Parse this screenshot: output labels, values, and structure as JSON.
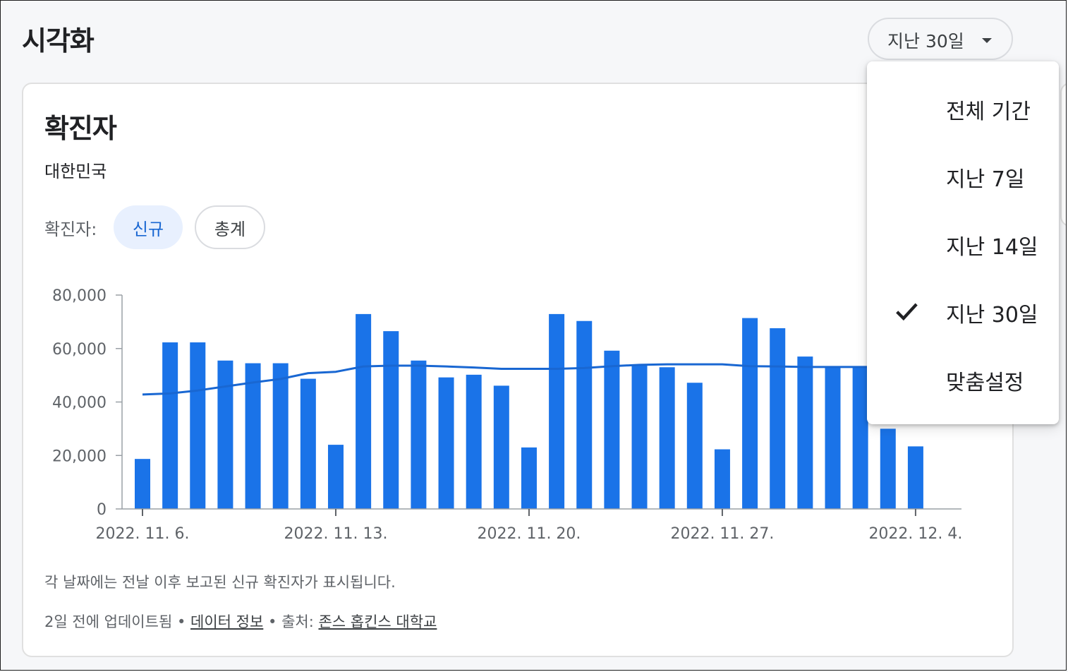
{
  "header": {
    "title": "시각화"
  },
  "range_button": {
    "label": "지난 30일"
  },
  "card": {
    "title": "확진자",
    "subtitle": "대한민국",
    "chip_label": "확진자:",
    "chips": [
      {
        "label": "신규",
        "selected": true
      },
      {
        "label": "총계",
        "selected": false
      }
    ],
    "note": "각 날짜에는 전날 이후 보고된 신규 확진자가 표시됩니다.",
    "footer": {
      "updated": "2일 전에 업데이트됨",
      "data_info": "데이터 정보",
      "source_label": "출처:",
      "source_link": "존스 홉킨스 대학교"
    }
  },
  "menu": {
    "items": [
      {
        "label": "전체 기간",
        "checked": false
      },
      {
        "label": "지난 7일",
        "checked": false
      },
      {
        "label": "지난 14일",
        "checked": false
      },
      {
        "label": "지난 30일",
        "checked": true
      },
      {
        "label": "맞춤설정",
        "checked": false
      }
    ]
  },
  "colors": {
    "bar": "#1a73e8",
    "line": "#1967d2",
    "accent": "#1967d2"
  },
  "chart_data": {
    "type": "bar",
    "ylim": [
      0,
      80000
    ],
    "yticks": [
      "80,000",
      "60,000",
      "40,000",
      "20,000",
      "0"
    ],
    "xtick_labels": [
      "2022. 11. 6.",
      "2022. 11. 13.",
      "2022. 11. 20.",
      "2022. 11. 27.",
      "2022. 12. 4."
    ],
    "series": [
      {
        "values": [
          18700,
          62300,
          62300,
          55500,
          54500,
          54500,
          48700,
          24000,
          72900,
          66500,
          55500,
          49200,
          50200,
          46100,
          23000,
          72900,
          70300,
          59200,
          54000,
          53000,
          47200,
          22300,
          71400,
          67600,
          57000,
          53000,
          53000,
          30000,
          23400
        ]
      },
      {
        "values": [
          42800,
          43200,
          44300,
          45800,
          47300,
          48600,
          50800,
          51300,
          53300,
          53600,
          53600,
          53300,
          52900,
          52400,
          52400,
          52400,
          52700,
          53400,
          53900,
          54100,
          54100,
          54100,
          53400,
          53300,
          53100,
          53100,
          53100,
          53100,
          53100
        ]
      }
    ]
  }
}
